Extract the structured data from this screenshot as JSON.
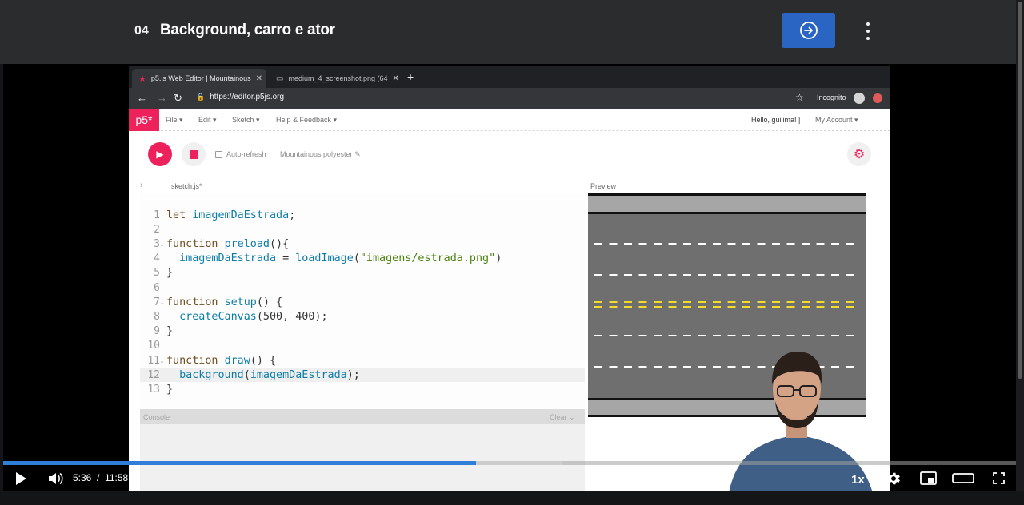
{
  "lesson": {
    "number": "04",
    "title": "Background, carro e ator",
    "next_icon": "arrow-right-circle-icon",
    "menu_icon": "kebab-icon"
  },
  "browser": {
    "tabs": [
      {
        "title": "p5.js Web Editor | Mountainous",
        "active": true
      },
      {
        "title": "medium_4_screenshot.png (64",
        "active": false
      }
    ],
    "url": "https://editor.p5js.org",
    "incognito_label": "Incognito"
  },
  "editor": {
    "logo": "p5*",
    "menus": [
      "File",
      "Edit",
      "Sketch",
      "Help & Feedback"
    ],
    "hello": "Hello, guilima!",
    "account": "My Account",
    "auto_refresh": "Auto-refresh",
    "sketch_name": "Mountainous polyester",
    "file_name": "sketch.js*",
    "preview_label": "Preview",
    "console_label": "Console",
    "clear_label": "Clear",
    "code_lines": [
      "let imagemDaEstrada;",
      "",
      "function preload(){",
      "  imagemDaEstrada = loadImage(\"imagens/estrada.png\")",
      "}",
      "",
      "function setup() {",
      "  createCanvas(500, 400);",
      "}",
      "",
      "function draw() {",
      "  background(imagemDaEstrada);",
      "}"
    ],
    "highlighted_line": 12
  },
  "player": {
    "current_time": "5:36",
    "separator": "/",
    "duration": "11:58",
    "played_fraction": 0.467,
    "buffered_fraction": 0.552,
    "speed": "1x"
  },
  "colors": {
    "accent_blue": "#2a65c4",
    "p5_pink": "#ed225d",
    "progress": "#2f7fd8"
  }
}
